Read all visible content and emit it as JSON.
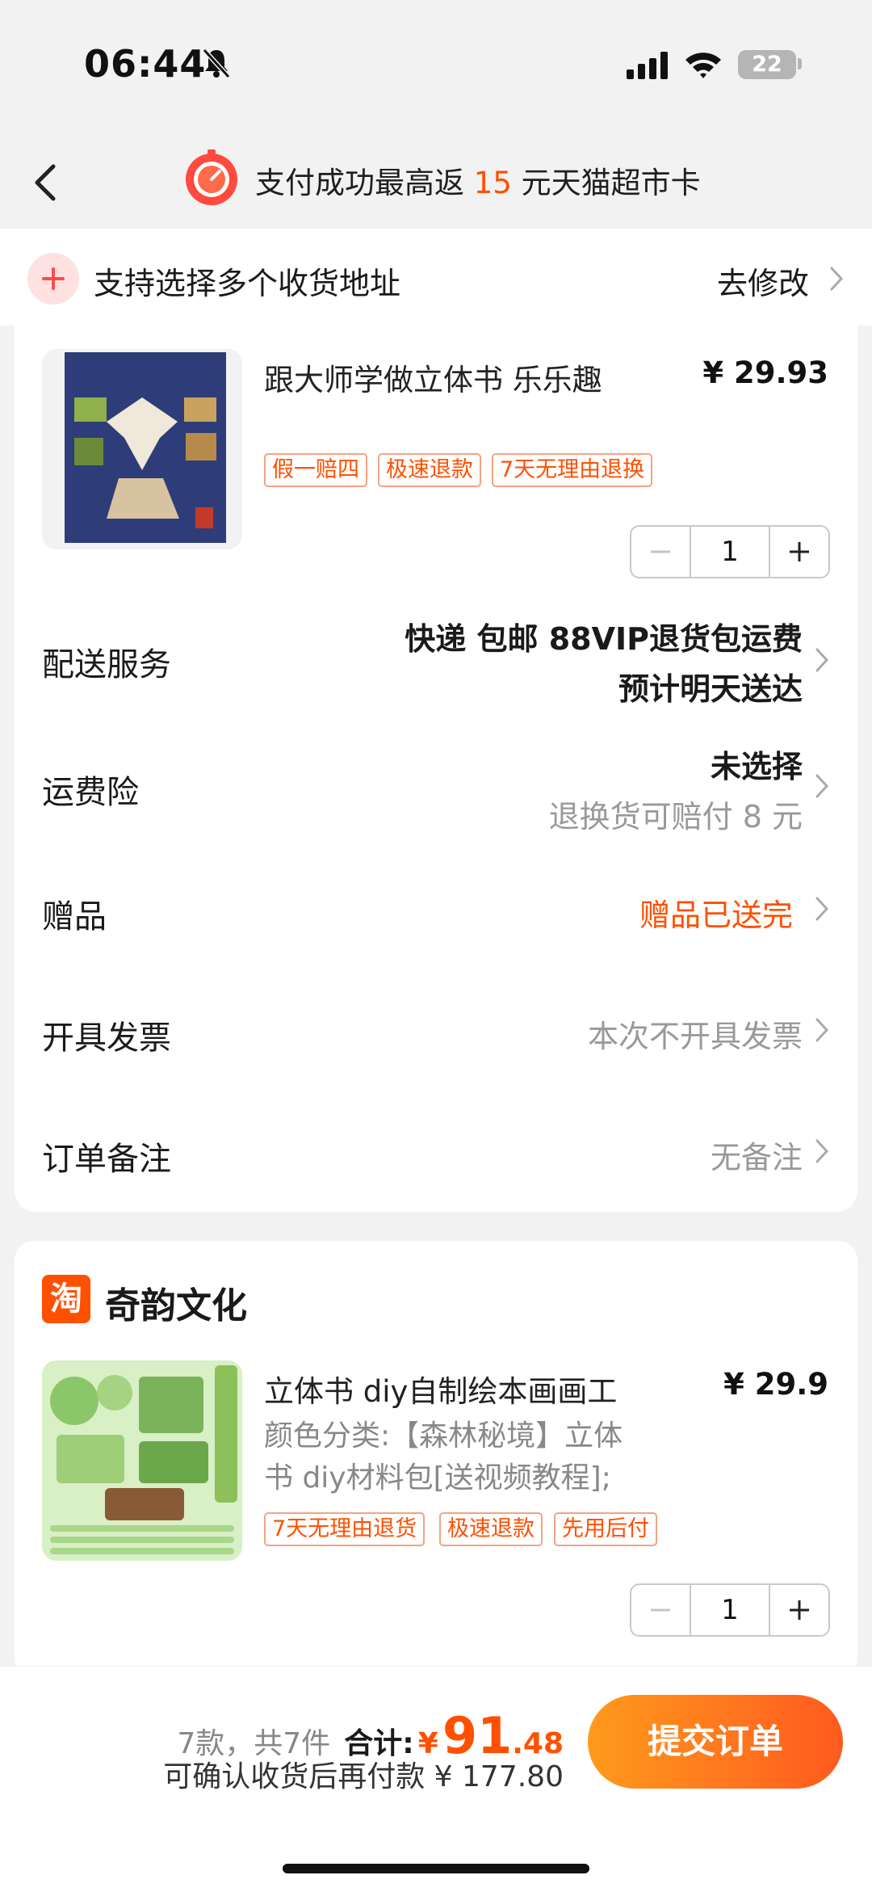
{
  "status_bar": {
    "time": "06:44",
    "battery": "22"
  },
  "promo": {
    "prefix": "支付成功最高返",
    "amount": "15",
    "suffix": "元天猫超市卡"
  },
  "address": {
    "text": "支持选择多个收货地址",
    "edit": "去修改"
  },
  "store1": {
    "product": {
      "title": "跟大师学做立体书 乐乐趣",
      "price": "¥ 29.93",
      "tags": [
        "假一赔四",
        "极速退款",
        "7天无理由退换"
      ],
      "quantity": "1"
    },
    "rows": {
      "delivery": {
        "label": "配送服务",
        "line1": "快递 包邮 88VIP退货包运费",
        "line2": "预计明天送达"
      },
      "insurance": {
        "label": "运费险",
        "line1": "未选择",
        "line2": "退换货可赔付 8 元"
      },
      "gift": {
        "label": "赠品",
        "value": "赠品已送完"
      },
      "invoice": {
        "label": "开具发票",
        "value": "本次不开具发票"
      },
      "note": {
        "label": "订单备注",
        "value": "无备注"
      }
    }
  },
  "store2": {
    "shop_icon": "淘",
    "shop_name": "奇韵文化",
    "product": {
      "title": "立体书 diy自制绘本画画工",
      "price": "¥ 29.9",
      "sku_line1": "颜色分类:【森林秘境】立体",
      "sku_line2": "书 diy材料包[送视频教程];",
      "tags": [
        "7天无理由退货",
        "极速退款",
        "先用后付"
      ],
      "quantity": "1"
    }
  },
  "bottom": {
    "count": "7款，共7件",
    "total_label": "合计:",
    "currency": "¥",
    "total_int": "91",
    "total_dec": ".48",
    "after_pay": "可确认收货后再付款 ¥ 177.80",
    "submit": "提交订单"
  },
  "colors": {
    "accent": "#ff5000",
    "button_start": "#ff9a1c",
    "button_end": "#ff5a1f"
  }
}
